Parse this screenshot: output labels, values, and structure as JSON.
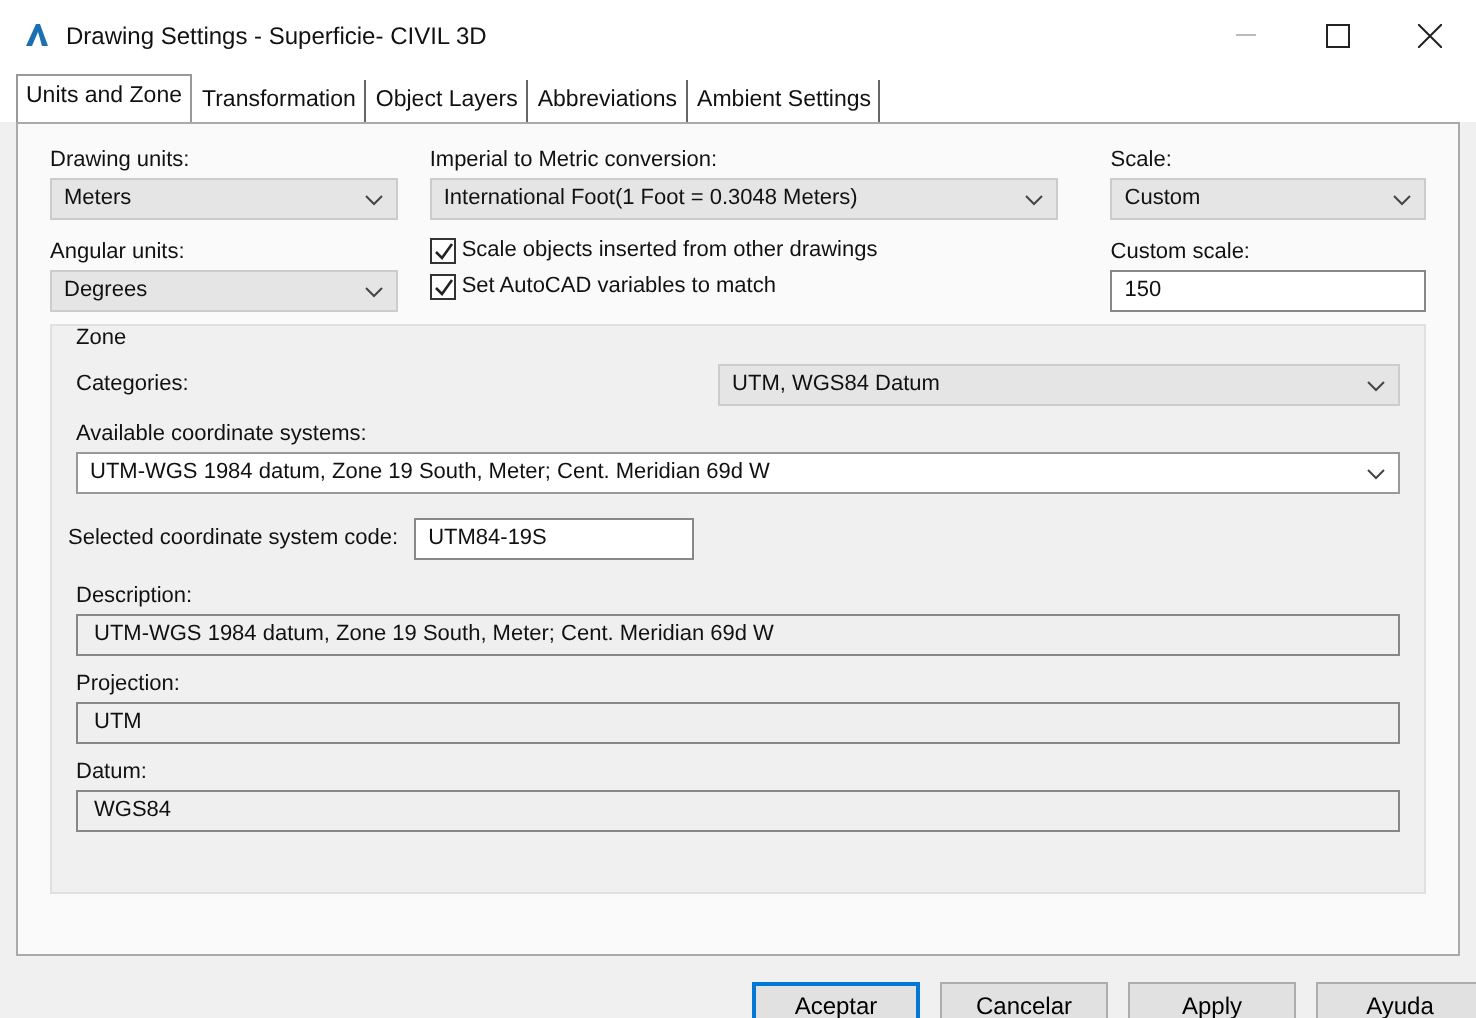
{
  "window": {
    "title": "Drawing Settings - Superficie- CIVIL 3D"
  },
  "tabs": [
    {
      "label": "Units and Zone",
      "selected": true
    },
    {
      "label": "Transformation",
      "selected": false
    },
    {
      "label": "Object Layers",
      "selected": false
    },
    {
      "label": "Abbreviations",
      "selected": false
    },
    {
      "label": "Ambient Settings",
      "selected": false
    }
  ],
  "units": {
    "drawing_units": {
      "label": "Drawing units:",
      "value": "Meters"
    },
    "conversion": {
      "label": "Imperial to Metric conversion:",
      "value": "International Foot(1 Foot = 0.3048 Meters)"
    },
    "scale": {
      "label": "Scale:",
      "value": "Custom"
    },
    "angular_units": {
      "label": "Angular units:",
      "value": "Degrees"
    },
    "checkboxes": [
      {
        "label": "Scale objects inserted from other drawings",
        "checked": true
      },
      {
        "label": "Set AutoCAD variables to match",
        "checked": true
      }
    ],
    "custom_scale": {
      "label": "Custom scale:",
      "value": "150"
    }
  },
  "zone": {
    "title": "Zone",
    "categories": {
      "label": "Categories:",
      "value": "UTM, WGS84 Datum"
    },
    "available": {
      "label": "Available coordinate systems:",
      "value": "UTM-WGS 1984 datum, Zone 19 South, Meter; Cent. Meridian 69d W"
    },
    "code": {
      "label": "Selected coordinate system code:",
      "value": "UTM84-19S"
    },
    "readonly_fields": [
      {
        "label": "Description:",
        "value": "UTM-WGS 1984 datum, Zone 19 South, Meter; Cent. Meridian 69d W"
      },
      {
        "label": "Projection:",
        "value": "UTM"
      },
      {
        "label": "Datum:",
        "value": "WGS84"
      }
    ]
  },
  "buttons": [
    {
      "label": "Aceptar",
      "default": true
    },
    {
      "label": "Cancelar",
      "default": false
    },
    {
      "label": "Apply",
      "default": false
    },
    {
      "label": "Ayuda",
      "default": false
    }
  ]
}
